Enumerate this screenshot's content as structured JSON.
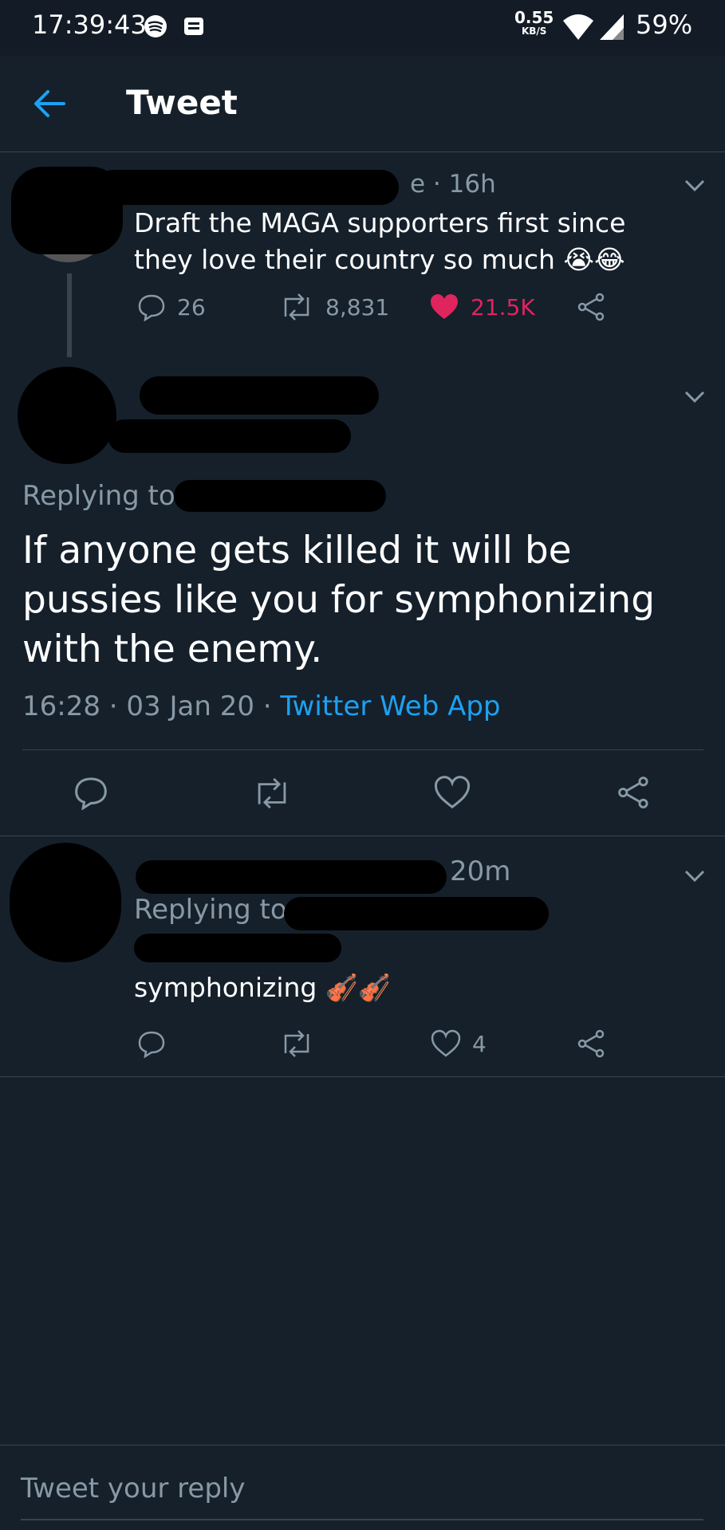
{
  "status_bar": {
    "time": "17:39:43",
    "speed_value": "0.55",
    "speed_unit": "KB/S",
    "battery": "59%"
  },
  "header": {
    "title": "Tweet"
  },
  "parent_tweet": {
    "time": "e · 16h",
    "text": "Draft the MAGA supporters first since they love their country so much 😭😂",
    "replies": "26",
    "retweets": "8,831",
    "likes": "21.5K"
  },
  "main_tweet": {
    "replying_to": "Replying to",
    "text": "If anyone gets killed it will be pussies like you for symphonizing with the enemy.",
    "timestamp": "16:28 · 03 Jan 20 ·",
    "source": "Twitter Web App"
  },
  "reply_tweet": {
    "time": "20m",
    "replying_to": "Replying to",
    "text": "symphonizing 🎻🎻",
    "likes": "4"
  },
  "composer": {
    "placeholder": "Tweet your reply"
  },
  "colors": {
    "background": "#15202b",
    "accent": "#1da1f2",
    "like": "#e0245e",
    "muted": "#8899a6"
  }
}
